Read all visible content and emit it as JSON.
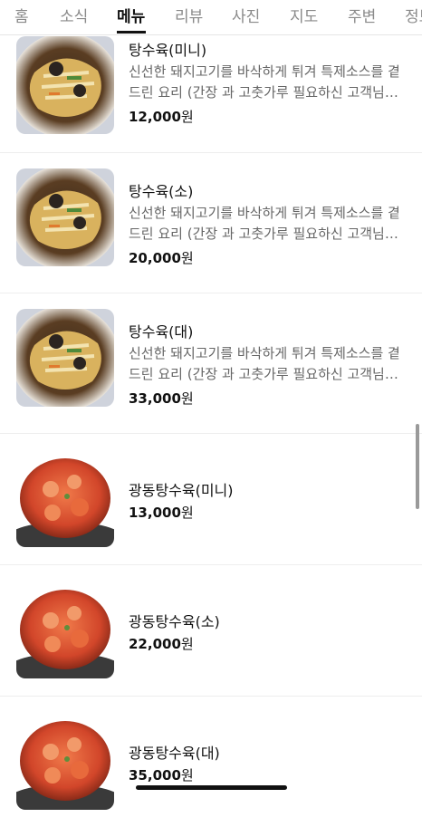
{
  "tabs": [
    "홈",
    "소식",
    "메뉴",
    "리뷰",
    "사진",
    "지도",
    "주변",
    "정보"
  ],
  "active_tab": "메뉴",
  "currency_unit": "원",
  "items": [
    {
      "name": "탕수육(미니)",
      "desc1": "신선한 돼지고기를 바삭하게 튀겨 특제소스를 곁",
      "desc2": "드린 요리 (간장 과 고춧가루 필요하신 고객님은...",
      "price": "12,000",
      "image": "tangsuyuk-photo"
    },
    {
      "name": "탕수육(소)",
      "desc1": "신선한 돼지고기를 바삭하게 튀겨 특제소스를 곁",
      "desc2": "드린 요리 (간장 과 고춧가루 필요하신 고객님은...",
      "price": "20,000",
      "image": "tangsuyuk-photo"
    },
    {
      "name": "탕수육(대)",
      "desc1": "신선한 돼지고기를 바삭하게 튀겨 특제소스를 곁",
      "desc2": "드린 요리 (간장 과 고춧가루 필요하신 고객님은...",
      "price": "33,000",
      "image": "tangsuyuk-photo"
    },
    {
      "name": "광동탕수육(미니)",
      "price": "13,000",
      "image": "guangdong-tangsuyuk-photo"
    },
    {
      "name": "광동탕수육(소)",
      "price": "22,000",
      "image": "guangdong-tangsuyuk-photo"
    },
    {
      "name": "광동탕수육(대)",
      "price": "35,000",
      "image": "guangdong-tangsuyuk-photo"
    }
  ]
}
